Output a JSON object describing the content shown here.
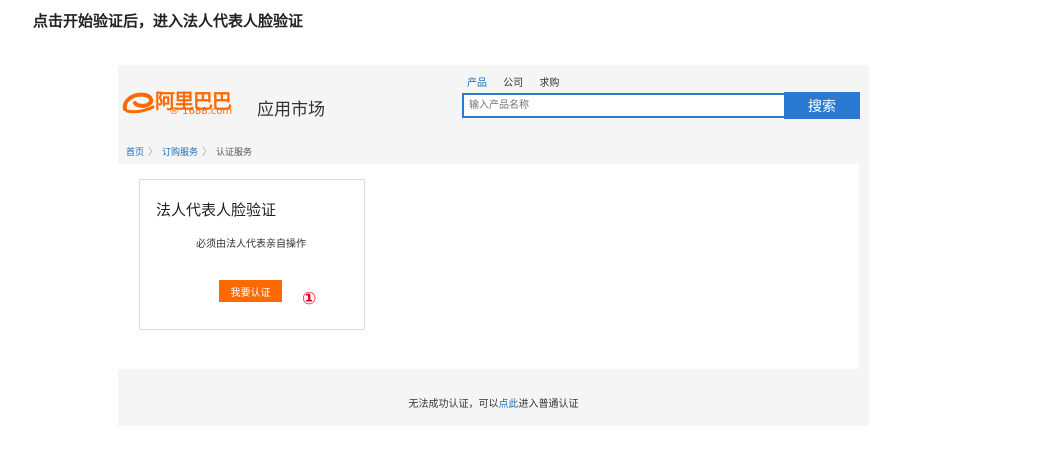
{
  "instruction": "点击开始验证后，进入法人代表人脸验证",
  "header": {
    "logo_text": "阿里巴巴",
    "logo_sub": "® 1688.com",
    "app_market": "应用市场",
    "search_tabs": [
      "产品",
      "公司",
      "求购"
    ],
    "search_placeholder": "输入产品名称",
    "search_button": "搜索"
  },
  "breadcrumb": {
    "items": [
      "首页",
      "订购服务",
      "认证服务"
    ],
    "separator": "〉"
  },
  "card": {
    "title": "法人代表人脸验证",
    "subtitle": "必须由法人代表亲自操作",
    "button": "我要认证",
    "step_marker": "①"
  },
  "footer": {
    "before": "无法成功认证，可以",
    "link": "点此",
    "after": "进入普通认证"
  },
  "colors": {
    "brand_orange": "#ff6a00",
    "search_blue": "#2a7ad3",
    "marker_red": "#e60012",
    "link_blue": "#1a6fb5"
  }
}
